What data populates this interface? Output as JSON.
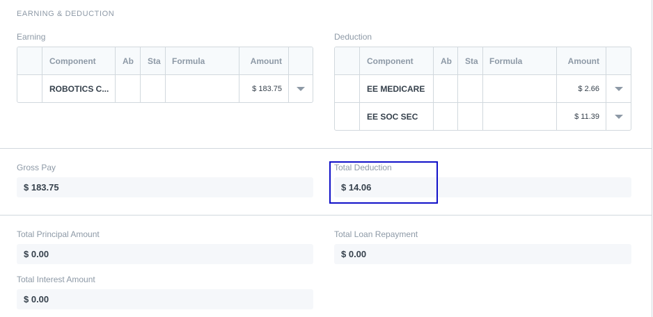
{
  "section": {
    "title": "EARNING & DEDUCTION"
  },
  "earning": {
    "label": "Earning",
    "headers": [
      "Component",
      "Ab",
      "Sta",
      "Formula",
      "Amount"
    ],
    "rows": [
      {
        "component": "ROBOTICS C...",
        "amount": "$ 183.75"
      }
    ]
  },
  "deduction": {
    "label": "Deduction",
    "headers": [
      "Component",
      "Ab",
      "Sta",
      "Formula",
      "Amount"
    ],
    "rows": [
      {
        "component": "EE MEDICARE",
        "amount": "$ 2.66"
      },
      {
        "component": "EE SOC SEC",
        "amount": "$ 11.39"
      }
    ]
  },
  "totals": {
    "gross_pay_label": "Gross Pay",
    "gross_pay": "$ 183.75",
    "total_deduction_label": "Total Deduction",
    "total_deduction": "$ 14.06"
  },
  "loans": {
    "principal_label": "Total Principal Amount",
    "principal": "$ 0.00",
    "repayment_label": "Total Loan Repayment",
    "repayment": "$ 0.00",
    "interest_label": "Total Interest Amount",
    "interest": "$ 0.00"
  },
  "icons": {
    "row_dropdown": "caret-down-icon"
  },
  "colors": {
    "highlight": "#1010c8",
    "border": "#d1d8dd",
    "muted_text": "#8d99a6"
  }
}
